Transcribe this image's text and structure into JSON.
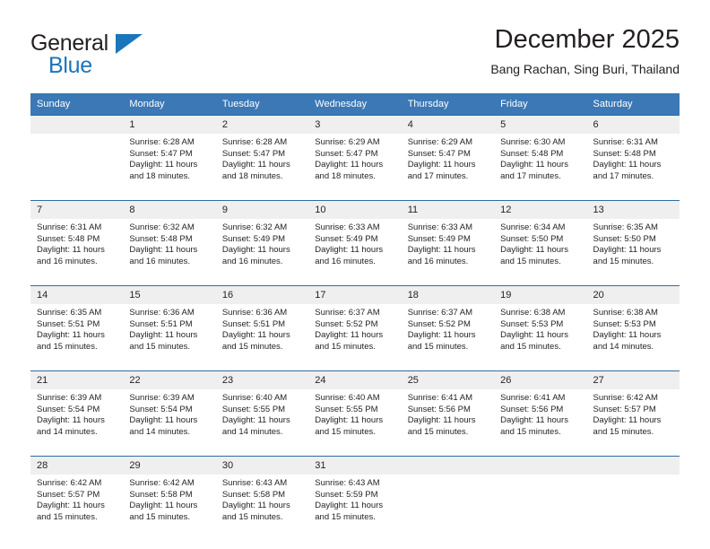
{
  "logo": {
    "text_top": "General",
    "text_bottom": "Blue",
    "triangle_color": "#1b75bb",
    "top_color": "#231f20"
  },
  "header": {
    "month_title": "December 2025",
    "location": "Bang Rachan, Sing Buri, Thailand"
  },
  "colors": {
    "header_blue": "#3b78b5",
    "separator_blue": "#2e6da4",
    "daynum_band": "#efefef",
    "text": "#231f20"
  },
  "weekdays": [
    "Sunday",
    "Monday",
    "Tuesday",
    "Wednesday",
    "Thursday",
    "Friday",
    "Saturday"
  ],
  "weeks": [
    {
      "days": [
        {
          "num": "",
          "sunrise": "",
          "sunset": "",
          "daylight_1": "",
          "daylight_2": ""
        },
        {
          "num": "1",
          "sunrise": "Sunrise: 6:28 AM",
          "sunset": "Sunset: 5:47 PM",
          "daylight_1": "Daylight: 11 hours",
          "daylight_2": "and 18 minutes."
        },
        {
          "num": "2",
          "sunrise": "Sunrise: 6:28 AM",
          "sunset": "Sunset: 5:47 PM",
          "daylight_1": "Daylight: 11 hours",
          "daylight_2": "and 18 minutes."
        },
        {
          "num": "3",
          "sunrise": "Sunrise: 6:29 AM",
          "sunset": "Sunset: 5:47 PM",
          "daylight_1": "Daylight: 11 hours",
          "daylight_2": "and 18 minutes."
        },
        {
          "num": "4",
          "sunrise": "Sunrise: 6:29 AM",
          "sunset": "Sunset: 5:47 PM",
          "daylight_1": "Daylight: 11 hours",
          "daylight_2": "and 17 minutes."
        },
        {
          "num": "5",
          "sunrise": "Sunrise: 6:30 AM",
          "sunset": "Sunset: 5:48 PM",
          "daylight_1": "Daylight: 11 hours",
          "daylight_2": "and 17 minutes."
        },
        {
          "num": "6",
          "sunrise": "Sunrise: 6:31 AM",
          "sunset": "Sunset: 5:48 PM",
          "daylight_1": "Daylight: 11 hours",
          "daylight_2": "and 17 minutes."
        }
      ]
    },
    {
      "days": [
        {
          "num": "7",
          "sunrise": "Sunrise: 6:31 AM",
          "sunset": "Sunset: 5:48 PM",
          "daylight_1": "Daylight: 11 hours",
          "daylight_2": "and 16 minutes."
        },
        {
          "num": "8",
          "sunrise": "Sunrise: 6:32 AM",
          "sunset": "Sunset: 5:48 PM",
          "daylight_1": "Daylight: 11 hours",
          "daylight_2": "and 16 minutes."
        },
        {
          "num": "9",
          "sunrise": "Sunrise: 6:32 AM",
          "sunset": "Sunset: 5:49 PM",
          "daylight_1": "Daylight: 11 hours",
          "daylight_2": "and 16 minutes."
        },
        {
          "num": "10",
          "sunrise": "Sunrise: 6:33 AM",
          "sunset": "Sunset: 5:49 PM",
          "daylight_1": "Daylight: 11 hours",
          "daylight_2": "and 16 minutes."
        },
        {
          "num": "11",
          "sunrise": "Sunrise: 6:33 AM",
          "sunset": "Sunset: 5:49 PM",
          "daylight_1": "Daylight: 11 hours",
          "daylight_2": "and 16 minutes."
        },
        {
          "num": "12",
          "sunrise": "Sunrise: 6:34 AM",
          "sunset": "Sunset: 5:50 PM",
          "daylight_1": "Daylight: 11 hours",
          "daylight_2": "and 15 minutes."
        },
        {
          "num": "13",
          "sunrise": "Sunrise: 6:35 AM",
          "sunset": "Sunset: 5:50 PM",
          "daylight_1": "Daylight: 11 hours",
          "daylight_2": "and 15 minutes."
        }
      ]
    },
    {
      "days": [
        {
          "num": "14",
          "sunrise": "Sunrise: 6:35 AM",
          "sunset": "Sunset: 5:51 PM",
          "daylight_1": "Daylight: 11 hours",
          "daylight_2": "and 15 minutes."
        },
        {
          "num": "15",
          "sunrise": "Sunrise: 6:36 AM",
          "sunset": "Sunset: 5:51 PM",
          "daylight_1": "Daylight: 11 hours",
          "daylight_2": "and 15 minutes."
        },
        {
          "num": "16",
          "sunrise": "Sunrise: 6:36 AM",
          "sunset": "Sunset: 5:51 PM",
          "daylight_1": "Daylight: 11 hours",
          "daylight_2": "and 15 minutes."
        },
        {
          "num": "17",
          "sunrise": "Sunrise: 6:37 AM",
          "sunset": "Sunset: 5:52 PM",
          "daylight_1": "Daylight: 11 hours",
          "daylight_2": "and 15 minutes."
        },
        {
          "num": "18",
          "sunrise": "Sunrise: 6:37 AM",
          "sunset": "Sunset: 5:52 PM",
          "daylight_1": "Daylight: 11 hours",
          "daylight_2": "and 15 minutes."
        },
        {
          "num": "19",
          "sunrise": "Sunrise: 6:38 AM",
          "sunset": "Sunset: 5:53 PM",
          "daylight_1": "Daylight: 11 hours",
          "daylight_2": "and 15 minutes."
        },
        {
          "num": "20",
          "sunrise": "Sunrise: 6:38 AM",
          "sunset": "Sunset: 5:53 PM",
          "daylight_1": "Daylight: 11 hours",
          "daylight_2": "and 14 minutes."
        }
      ]
    },
    {
      "days": [
        {
          "num": "21",
          "sunrise": "Sunrise: 6:39 AM",
          "sunset": "Sunset: 5:54 PM",
          "daylight_1": "Daylight: 11 hours",
          "daylight_2": "and 14 minutes."
        },
        {
          "num": "22",
          "sunrise": "Sunrise: 6:39 AM",
          "sunset": "Sunset: 5:54 PM",
          "daylight_1": "Daylight: 11 hours",
          "daylight_2": "and 14 minutes."
        },
        {
          "num": "23",
          "sunrise": "Sunrise: 6:40 AM",
          "sunset": "Sunset: 5:55 PM",
          "daylight_1": "Daylight: 11 hours",
          "daylight_2": "and 14 minutes."
        },
        {
          "num": "24",
          "sunrise": "Sunrise: 6:40 AM",
          "sunset": "Sunset: 5:55 PM",
          "daylight_1": "Daylight: 11 hours",
          "daylight_2": "and 15 minutes."
        },
        {
          "num": "25",
          "sunrise": "Sunrise: 6:41 AM",
          "sunset": "Sunset: 5:56 PM",
          "daylight_1": "Daylight: 11 hours",
          "daylight_2": "and 15 minutes."
        },
        {
          "num": "26",
          "sunrise": "Sunrise: 6:41 AM",
          "sunset": "Sunset: 5:56 PM",
          "daylight_1": "Daylight: 11 hours",
          "daylight_2": "and 15 minutes."
        },
        {
          "num": "27",
          "sunrise": "Sunrise: 6:42 AM",
          "sunset": "Sunset: 5:57 PM",
          "daylight_1": "Daylight: 11 hours",
          "daylight_2": "and 15 minutes."
        }
      ]
    },
    {
      "days": [
        {
          "num": "28",
          "sunrise": "Sunrise: 6:42 AM",
          "sunset": "Sunset: 5:57 PM",
          "daylight_1": "Daylight: 11 hours",
          "daylight_2": "and 15 minutes."
        },
        {
          "num": "29",
          "sunrise": "Sunrise: 6:42 AM",
          "sunset": "Sunset: 5:58 PM",
          "daylight_1": "Daylight: 11 hours",
          "daylight_2": "and 15 minutes."
        },
        {
          "num": "30",
          "sunrise": "Sunrise: 6:43 AM",
          "sunset": "Sunset: 5:58 PM",
          "daylight_1": "Daylight: 11 hours",
          "daylight_2": "and 15 minutes."
        },
        {
          "num": "31",
          "sunrise": "Sunrise: 6:43 AM",
          "sunset": "Sunset: 5:59 PM",
          "daylight_1": "Daylight: 11 hours",
          "daylight_2": "and 15 minutes."
        },
        {
          "num": "",
          "sunrise": "",
          "sunset": "",
          "daylight_1": "",
          "daylight_2": ""
        },
        {
          "num": "",
          "sunrise": "",
          "sunset": "",
          "daylight_1": "",
          "daylight_2": ""
        },
        {
          "num": "",
          "sunrise": "",
          "sunset": "",
          "daylight_1": "",
          "daylight_2": ""
        }
      ]
    }
  ]
}
